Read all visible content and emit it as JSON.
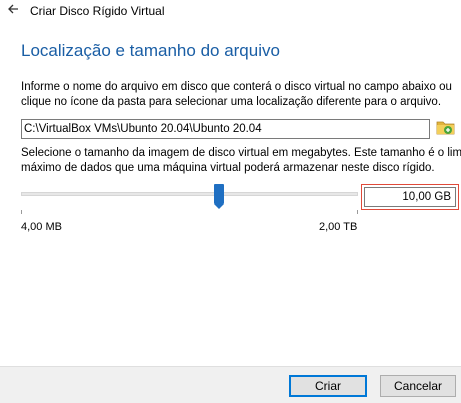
{
  "window": {
    "title": "Criar Disco Rígido Virtual"
  },
  "page": {
    "heading": "Localização e tamanho do arquivo",
    "intro_line1": "Informe o nome do arquivo em disco que conterá o disco virtual no campo abaixo ou",
    "intro_line2": "clique no ícone da pasta para selecionar uma localização diferente para o arquivo.",
    "file_path": "C:\\VirtualBox VMs\\Ubunto 20.04\\Ubunto 20.04",
    "size_line1": "Selecione o tamanho da imagem de disco virtual em megabytes. Este tamanho é o limite",
    "size_line2": "máximo de dados que uma máquina virtual poderá armazenar neste disco rígido.",
    "size_value": "10,00 GB",
    "slider_min_label": "4,00 MB",
    "slider_max_label": "2,00 TB",
    "slider_position_fraction": 0.59
  },
  "icons": {
    "back": "back-arrow-icon",
    "folder": "folder-icon"
  },
  "colors": {
    "heading": "#1a5ea5",
    "accent": "#0078d7",
    "highlight": "#e04a3a"
  },
  "buttons": {
    "create": "Criar",
    "cancel": "Cancelar"
  }
}
